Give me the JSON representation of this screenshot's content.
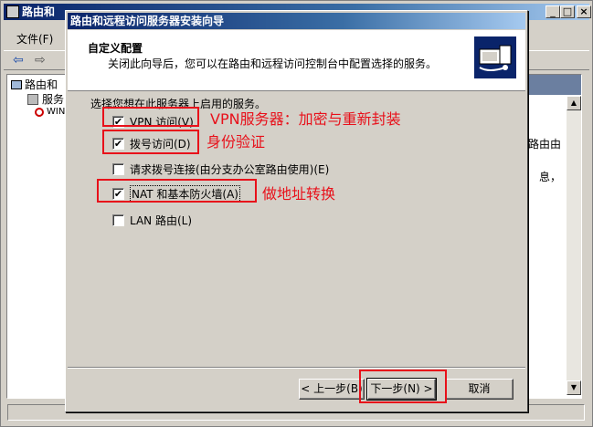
{
  "main_window": {
    "title": "路由和",
    "menu_file": "文件(F)",
    "tree_root": "路由和",
    "tree_item_1": "服务",
    "tree_item_2": "WIN",
    "right_fragment_1": "路由由",
    "right_fragment_2": "息，"
  },
  "wizard": {
    "title": "路由和远程访问服务器安装向导",
    "header_title": "自定义配置",
    "header_desc": "关闭此向导后，您可以在路由和远程访问控制台中配置选择的服务。",
    "prompt": "选择您想在此服务器上启用的服务。",
    "options": [
      {
        "label": "VPN 访问(V)",
        "checked": true
      },
      {
        "label": "拨号访问(D)",
        "checked": true
      },
      {
        "label": "请求拨号连接(由分支办公室路由使用)(E)",
        "checked": false
      },
      {
        "label": "NAT 和基本防火墙(A)",
        "checked": true
      },
      {
        "label": "LAN 路由(L)",
        "checked": false
      }
    ],
    "btn_back": "< 上一步(B)",
    "btn_next": "下一步(N) >",
    "btn_cancel": "取消"
  },
  "annotations": {
    "vpn": "VPN服务器：加密与重新封装",
    "dialup": "身份验证",
    "nat": "做地址转换",
    "color": "#e8101a"
  },
  "icons": {
    "check": "✔",
    "minimize": "_",
    "maximize": "□",
    "close": "×",
    "scroll_up": "▲",
    "scroll_down": "▼",
    "arrow_left": "⇦",
    "arrow_right": "⇨"
  }
}
